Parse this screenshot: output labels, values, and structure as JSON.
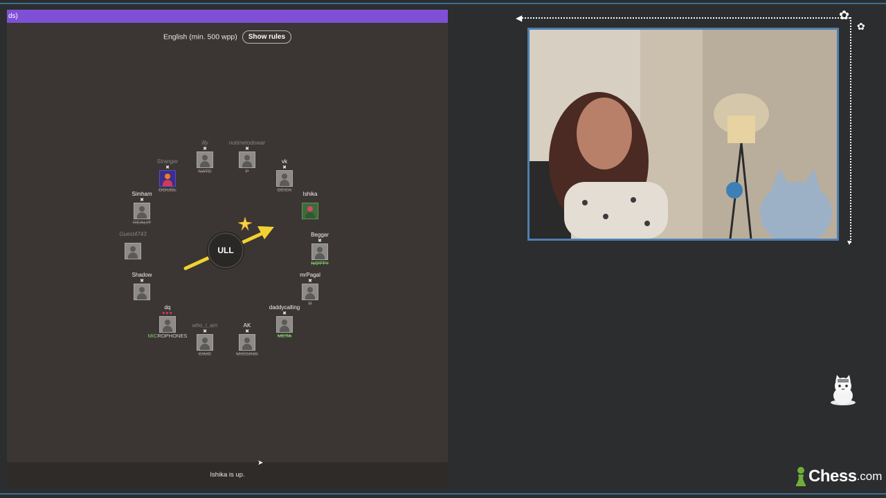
{
  "game": {
    "topbar_text": "ds)",
    "language_label": "English (min. 500 wpp)",
    "show_rules_label": "Show rules",
    "bomb_syllable": "ULL",
    "status_text": "Ishika is up.",
    "players": [
      {
        "name": "illy",
        "word": "NATE",
        "hearts": "✖",
        "dim": true,
        "word_style": "struck"
      },
      {
        "name": "notimetodowar",
        "word": "P",
        "hearts": "✖",
        "dim": true,
        "word_style": "struck"
      },
      {
        "name": "vk",
        "word": "DECK",
        "hearts": "✖",
        "dim": false,
        "word_style": "struck"
      },
      {
        "name": "Ishika",
        "word": "",
        "hearts": "",
        "dim": false,
        "word_style": "struck"
      },
      {
        "name": "Beggar",
        "word": "NOTTY",
        "hearts": "✖",
        "dim": false,
        "word_style": "green"
      },
      {
        "name": "mrPagal",
        "word": "B",
        "hearts": "✖",
        "dim": false,
        "word_style": "struck"
      },
      {
        "name": "daddycalling",
        "word": "META",
        "hearts": "✖",
        "dim": false,
        "word_style": "green"
      },
      {
        "name": "AK",
        "word": "MISSING",
        "hearts": "✖",
        "dim": false,
        "word_style": "struck"
      },
      {
        "name": "who_i_am",
        "word": "CIME",
        "hearts": "✖",
        "dim": true,
        "word_style": "struck"
      },
      {
        "name": "dq",
        "word_green": "MIC",
        "word_rest": "ROPHONES",
        "hearts": "♥♥♥",
        "dim": false,
        "word_style": "mix"
      },
      {
        "name": "Shadow",
        "word": "",
        "hearts": "✖",
        "dim": false,
        "word_style": "struck"
      },
      {
        "name": "Guest4743",
        "word": "",
        "hearts": "",
        "dim": true,
        "word_style": "struck"
      },
      {
        "name": "Simham",
        "word": "REALIT",
        "hearts": "✖",
        "dim": false,
        "word_style": "struck"
      },
      {
        "name": "Stranger",
        "word": "DOUBL",
        "hearts": "✖",
        "dim": true,
        "word_style": "struck"
      }
    ]
  },
  "webcam": {
    "description_alt": "streamer webcam"
  },
  "brand": {
    "name": "Chess",
    "suffix": ".com"
  },
  "colors": {
    "accent_purple": "#7f4fd6",
    "frame_blue": "#4f7fb0",
    "arrow_yellow": "#f2d230",
    "correct_green": "#7ed26a"
  },
  "icons": {
    "corner_flowers": "flower-icon",
    "cat_sticker": "cat-sticker-icon",
    "pawn": "pawn-icon"
  }
}
